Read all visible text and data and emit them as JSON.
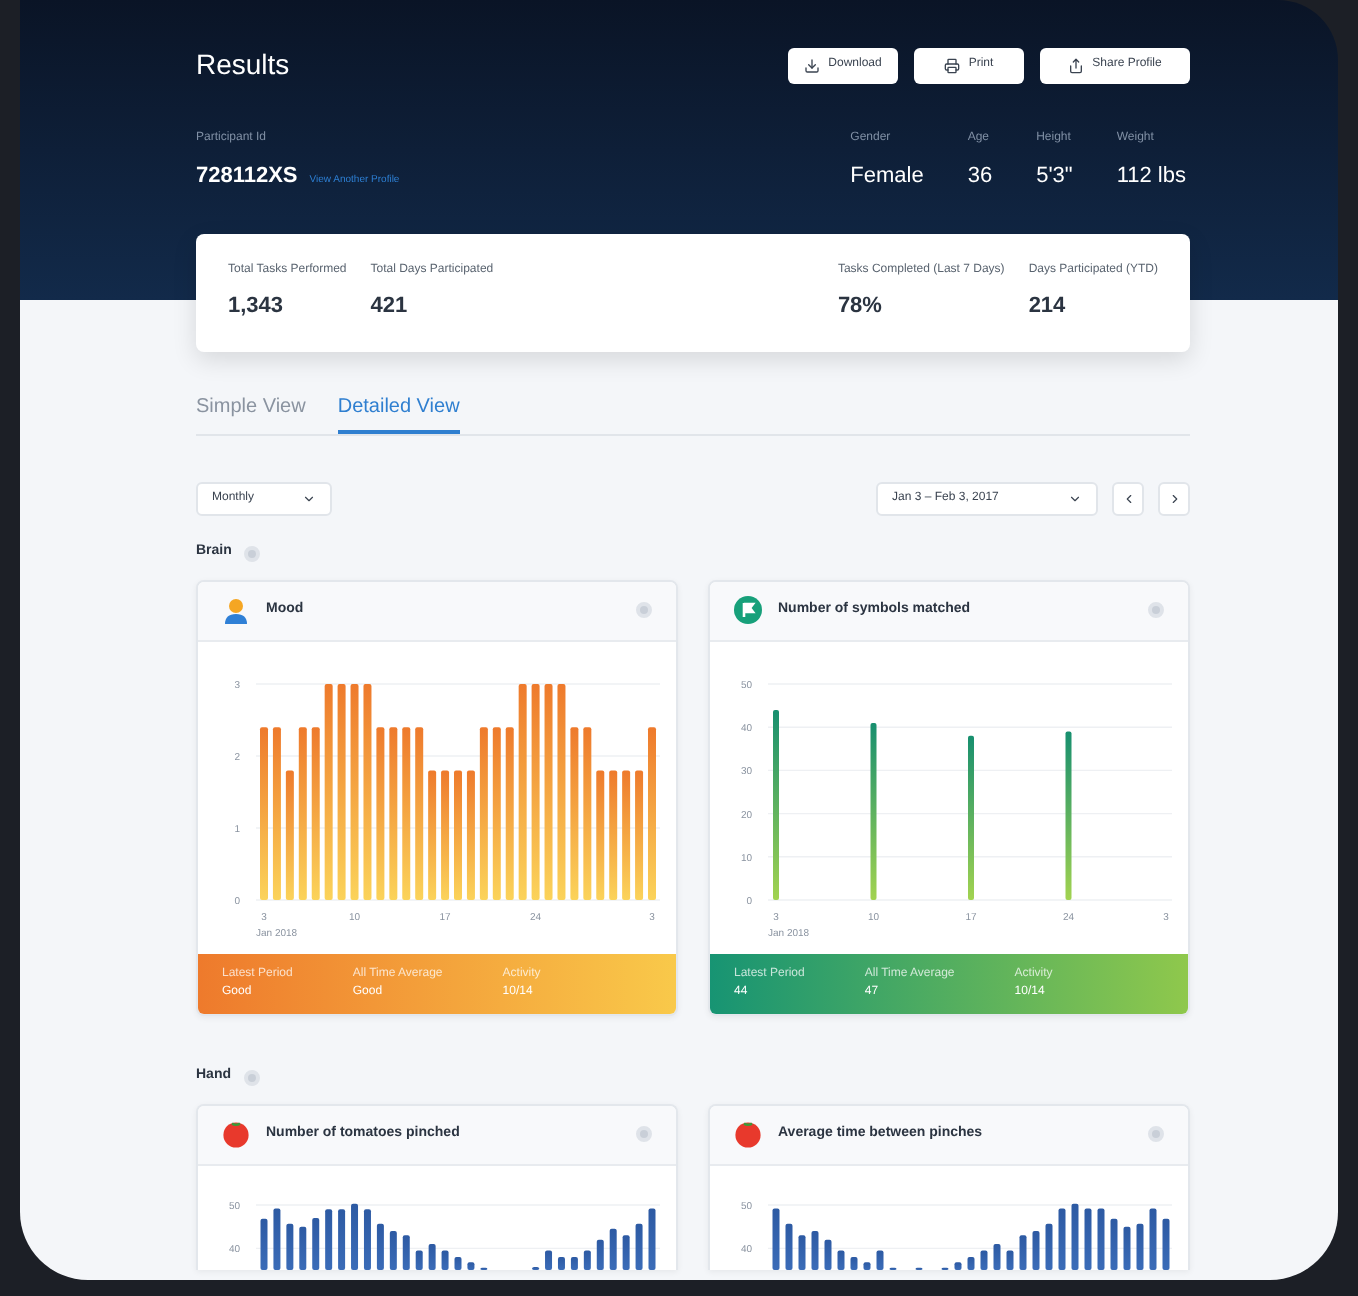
{
  "header": {
    "title": "Results",
    "buttons": [
      {
        "label": "Download"
      },
      {
        "label": "Print"
      },
      {
        "label": "Share Profile"
      }
    ]
  },
  "participant": {
    "label": "Participant Id",
    "id": "728112XS",
    "link": "View Another Profile"
  },
  "demographics": [
    {
      "label": "Gender",
      "value": "Female"
    },
    {
      "label": "Age",
      "value": "36"
    },
    {
      "label": "Height",
      "value": "5'3\""
    },
    {
      "label": "Weight",
      "value": "112 lbs"
    }
  ],
  "summary": [
    {
      "label": "Total Tasks Performed",
      "value": "1,343"
    },
    {
      "label": "Total Days Participated",
      "value": "421"
    },
    {
      "label": "Tasks Completed (Last 7 Days)",
      "value": "78%"
    },
    {
      "label": "Days Participated (YTD)",
      "value": "214"
    }
  ],
  "tabs": [
    {
      "label": "Simple View",
      "selected": false
    },
    {
      "label": "Detailed View",
      "selected": true
    }
  ],
  "filters": {
    "period": "Monthly",
    "date_range": "Jan 3 – Feb 3, 2017"
  },
  "sections": [
    {
      "title": "Brain",
      "cards": [
        {
          "title": "Mood",
          "x_start_label": "Jan 2018",
          "chart_data": {
            "type": "bar",
            "x": [
              3,
              4,
              5,
              6,
              7,
              8,
              9,
              10,
              11,
              12,
              13,
              14,
              15,
              16,
              17,
              18,
              19,
              20,
              21,
              22,
              23,
              24,
              25,
              26,
              27,
              28,
              29,
              30,
              31,
              32,
              33
            ],
            "values": [
              2.4,
              2.4,
              1.8,
              2.4,
              2.4,
              3,
              3,
              3,
              3,
              2.4,
              2.4,
              2.4,
              2.4,
              1.8,
              1.8,
              1.8,
              1.8,
              2.4,
              2.4,
              2.4,
              3,
              3,
              3,
              3,
              2.4,
              2.4,
              1.8,
              1.8,
              1.8,
              1.8,
              2.4
            ],
            "ylim": [
              0,
              3
            ],
            "xlim": [
              3,
              33
            ],
            "yticks": [
              0,
              1,
              2,
              3
            ],
            "grid": true,
            "xticks": [
              {
                "value": 3,
                "label": "3"
              },
              {
                "value": 10,
                "label": "10"
              },
              {
                "value": 17,
                "label": "17"
              },
              {
                "value": 24,
                "label": "24"
              }
            ]
          },
          "x_end_label": "3",
          "footer": [
            {
              "label": "Latest Period",
              "value": "Good"
            },
            {
              "label": "All Time Average",
              "value": "Good"
            },
            {
              "label": "Activity",
              "value": "10/14"
            }
          ]
        },
        {
          "title": "Number of symbols matched",
          "x_start_label": "Jan 2018",
          "chart_data": {
            "type": "bar",
            "categories": [
              "3",
              "10",
              "17",
              "24",
              "3"
            ],
            "values": [
              44,
              41,
              38,
              39,
              null
            ],
            "ylim": [
              0,
              50
            ],
            "yticks": [
              0,
              10,
              20,
              30,
              40,
              50
            ],
            "grid": true
          },
          "footer": [
            {
              "label": "Latest Period",
              "value": "44"
            },
            {
              "label": "All Time Average",
              "value": "47"
            },
            {
              "label": "Activity",
              "value": "10/14"
            }
          ]
        }
      ]
    },
    {
      "title": "Hand",
      "cards": [
        {
          "title": "Number of tomatoes pinched",
          "chart_data": {
            "type": "bar",
            "values": [
              46.8,
              49.2,
              45.7,
              45,
              47,
              49,
              49,
              50.3,
              49,
              45.7,
              44,
              43,
              39.5,
              41,
              39.5,
              38,
              36.8,
              35.5,
              null,
              35,
              null,
              35.7,
              39.5,
              38,
              38,
              39.5,
              42,
              44.5,
              43,
              45.7,
              49.2
            ],
            "ylim": [
              35,
              59
            ],
            "yticks": [
              40,
              50
            ],
            "grid": true
          }
        },
        {
          "title": "Average time between pinches",
          "chart_data": {
            "type": "bar",
            "values": [
              49.2,
              45.7,
              43,
              44,
              42,
              39.5,
              38,
              36.8,
              39.5,
              35.5,
              null,
              35.5,
              null,
              35.5,
              36.8,
              38,
              39.5,
              41,
              39.5,
              43,
              44,
              45.7,
              49.2,
              50.3,
              49.2,
              49.2,
              46.8,
              45,
              45.7,
              49.2,
              46.8
            ],
            "ylim": [
              35,
              59
            ],
            "yticks": [
              40,
              50
            ],
            "grid": true
          }
        }
      ]
    }
  ]
}
